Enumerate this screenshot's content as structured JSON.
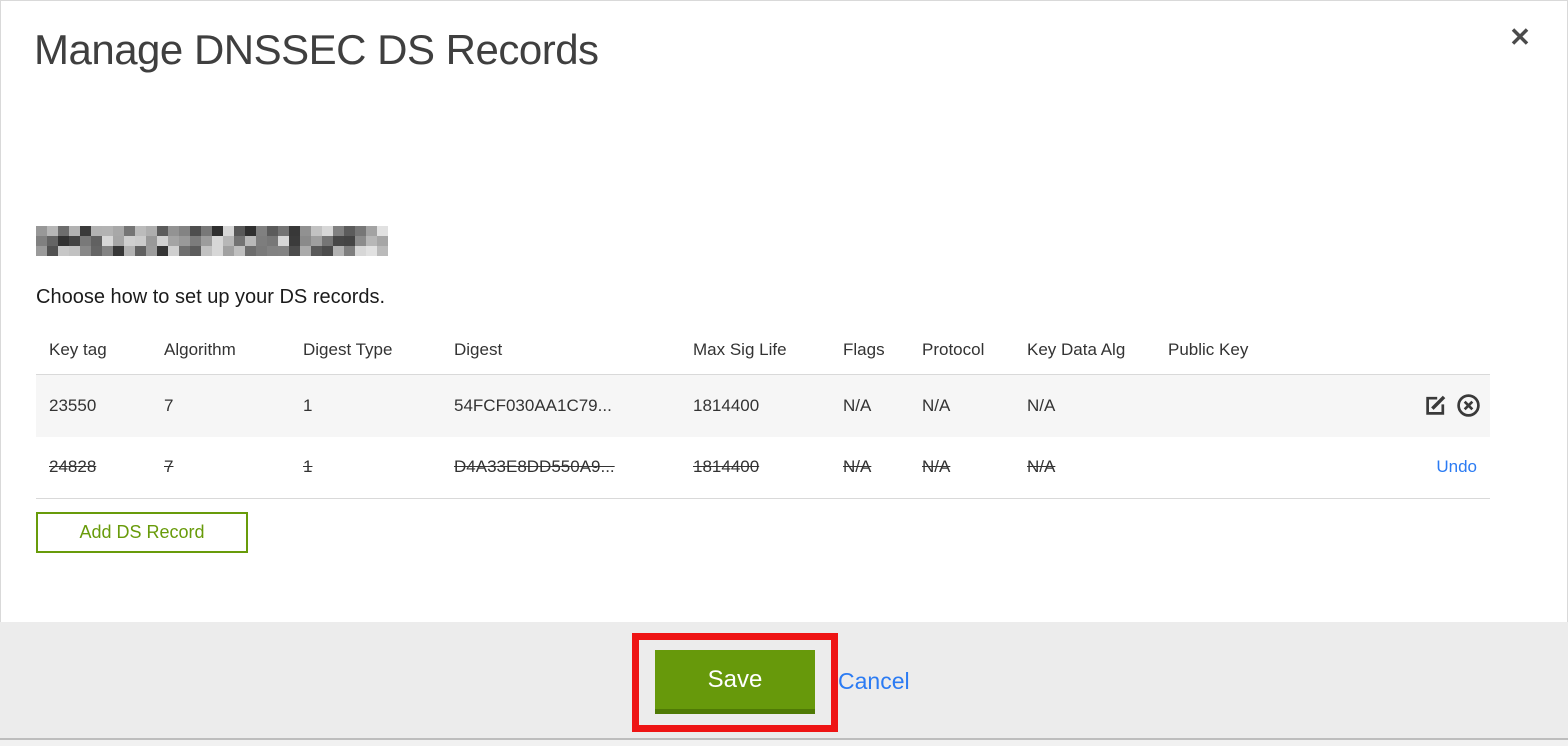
{
  "modal": {
    "title": "Manage DNSSEC DS Records",
    "close_glyph": "✕",
    "domain": {
      "redacted": true
    },
    "instruction": "Choose how to set up your DS records.",
    "table": {
      "headers": [
        "Key tag",
        "Algorithm",
        "Digest Type",
        "Digest",
        "Max Sig Life",
        "Flags",
        "Protocol",
        "Key Data Alg",
        "Public Key"
      ],
      "rows": [
        {
          "key_tag": "23550",
          "algorithm": "7",
          "digest_type": "1",
          "digest": "54FCF030AA1C79...",
          "max_sig_life": "1814400",
          "flags": "N/A",
          "protocol": "N/A",
          "key_data_alg": "N/A",
          "public_key": "",
          "deleted": false
        },
        {
          "key_tag": "24828",
          "algorithm": "7",
          "digest_type": "1",
          "digest": "D4A33E8DD550A9...",
          "max_sig_life": "1814400",
          "flags": "N/A",
          "protocol": "N/A",
          "key_data_alg": "N/A",
          "public_key": "",
          "deleted": true,
          "undo_label": "Undo"
        }
      ]
    },
    "add_button_label": "Add DS Record",
    "footer": {
      "save_label": "Save",
      "cancel_label": "Cancel"
    },
    "colors": {
      "accent_green": "#689b0a",
      "save_button_green": "#67990b",
      "save_button_border": "#4f7a05",
      "link_blue": "#2b7bf3",
      "annotation_red": "#ee1414",
      "footer_gray": "#ececec",
      "row_highlight_gray": "#f6f6f6"
    }
  }
}
